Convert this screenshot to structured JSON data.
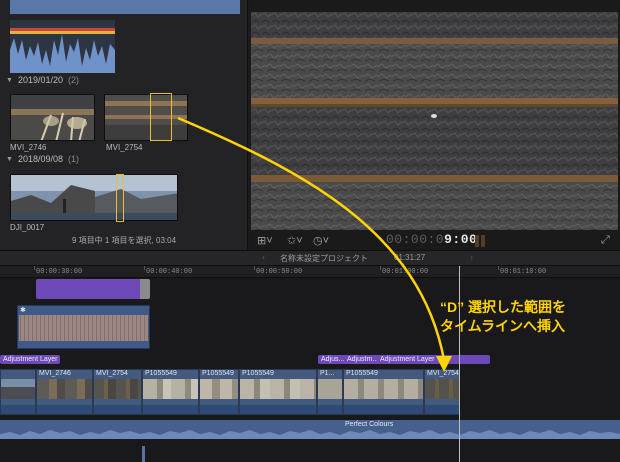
{
  "browser": {
    "groups": [
      {
        "date": "2019/01/20",
        "count": "(2)"
      },
      {
        "date": "2018/09/08",
        "count": "(1)"
      }
    ],
    "clips": [
      {
        "name": "MVI_2746"
      },
      {
        "name": "MVI_2754"
      },
      {
        "name": "DJI_0017"
      }
    ],
    "status": "9 項目中 1 項目を選択, 03:04"
  },
  "viewer": {
    "timecode_dim": "00:00:0",
    "timecode_bright": "9:00",
    "tools": {
      "crop": "crop-icon",
      "transform": "transform-icon",
      "speed": "speed-icon",
      "fullscreen": "fullscreen-icon"
    }
  },
  "timeline": {
    "project_title": "名称未設定プロジェクト",
    "project_duration": "01:31:27",
    "ruler": [
      "00:00:30:00",
      "00:00:40:00",
      "00:00:50:00",
      "00:01:00:00",
      "00:01:10:00"
    ],
    "adjustment_labels": [
      "Adjustment Layer",
      "Adjus...",
      "Adjustm...",
      "Adjustment Layer"
    ],
    "clips": [
      {
        "label": ""
      },
      {
        "label": "MVI_2746"
      },
      {
        "label": "MVI_2754"
      },
      {
        "label": "P1055549"
      },
      {
        "label": "P1055549"
      },
      {
        "label": "P1055549"
      },
      {
        "label": "P1..."
      },
      {
        "label": "P1055549"
      },
      {
        "label": "MVI_2754"
      }
    ],
    "music_label": "Perfect Colours",
    "connected_clip_marker": "✱"
  },
  "annotation": {
    "line1": "“D” 選択した範囲を",
    "line2": "タイムラインへ挿入",
    "color": "#ffd400"
  },
  "colors": {
    "selection": "#e8c12a",
    "adjustment": "#6e49b8",
    "video_clip": "#43597e",
    "audio": "#45608d"
  }
}
